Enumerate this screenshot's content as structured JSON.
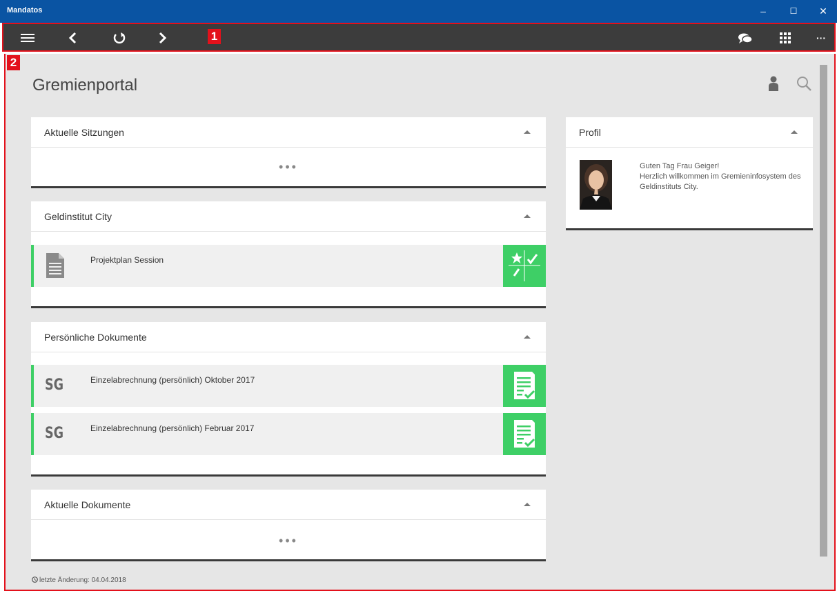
{
  "window": {
    "title": "Mandatos",
    "minimize": "–",
    "maximize": "☐",
    "close": "✕"
  },
  "toolbar": {
    "menu_icon": "hamburger-icon",
    "back_icon": "chevron-left-icon",
    "refresh_icon": "refresh-icon",
    "forward_icon": "chevron-right-icon",
    "chat_icon": "chat-icon",
    "apps_icon": "grid-icon",
    "more_label": "···",
    "badge": "1"
  },
  "content": {
    "badge": "2",
    "page_title": "Gremienportal",
    "user_icon": "person-icon",
    "search_icon": "search-icon"
  },
  "cards": {
    "sitzungen": {
      "title": "Aktuelle Sitzungen",
      "dots": "•••"
    },
    "geldinstitut": {
      "title": "Geldinstitut City",
      "rows": [
        {
          "label": "Projektplan Session"
        }
      ]
    },
    "persoenlich": {
      "title": "Persönliche Dokumente",
      "rows": [
        {
          "initials": "SG",
          "label": "Einzelabrechnung (persönlich) Oktober 2017"
        },
        {
          "initials": "SG",
          "label": "Einzelabrechnung (persönlich) Februar 2017"
        }
      ]
    },
    "aktuelle_dokumente": {
      "title": "Aktuelle Dokumente",
      "dots": "•••"
    },
    "profil": {
      "title": "Profil",
      "greeting": "Guten Tag Frau Geiger!",
      "welcome": "Herzlich willkommen im Gremieninfosystem des Geldinstituts City."
    }
  },
  "footer": {
    "last_change": "letzte Änderung: 04.04.2018"
  },
  "colors": {
    "accent": "#3ecf66",
    "titlebar": "#0a54a3",
    "toolbar": "#3c3c3c",
    "highlight": "#e3111b"
  }
}
